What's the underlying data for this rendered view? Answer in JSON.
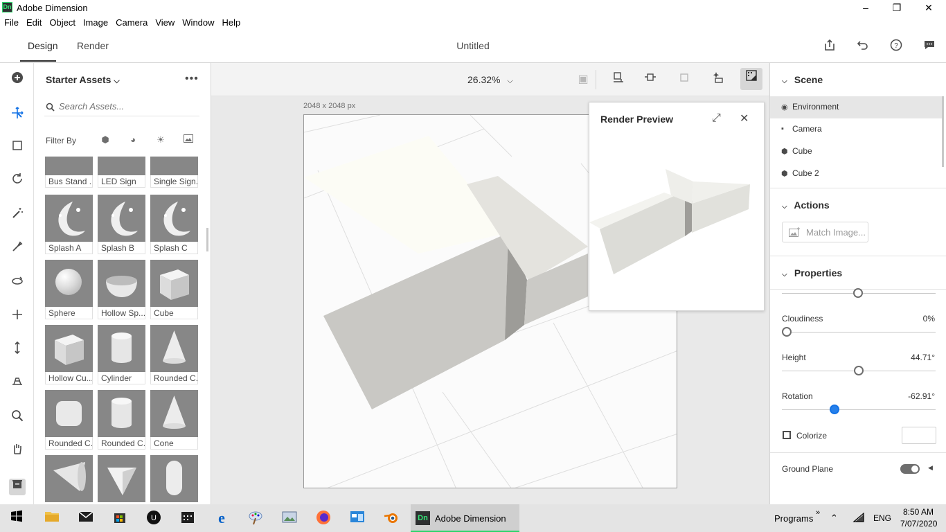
{
  "window": {
    "title": "Adobe Dimension",
    "logo_text": "Dn"
  },
  "menu": [
    "File",
    "Edit",
    "Object",
    "Image",
    "Camera",
    "View",
    "Window",
    "Help"
  ],
  "header": {
    "tabs": [
      {
        "label": "Design",
        "active": true
      },
      {
        "label": "Render",
        "active": false
      }
    ],
    "doc_title": "Untitled",
    "icons": [
      "share-icon",
      "undo-icon",
      "help-icon",
      "feedback-icon"
    ]
  },
  "tools": [
    "add-icon",
    "select-icon",
    "marquee-icon",
    "orbit-icon",
    "magic-wand-icon",
    "sampler-icon",
    "rotate-icon",
    "move-icon",
    "scale-icon",
    "camera-orbit-icon",
    "zoom-icon",
    "pan-icon",
    "library-icon"
  ],
  "assets": {
    "title": "Starter Assets",
    "search_placeholder": "Search Assets...",
    "filter_label": "Filter By",
    "items": [
      {
        "label": "Bus Stand ...",
        "kind": "dark"
      },
      {
        "label": "LED Sign",
        "kind": "dark"
      },
      {
        "label": "Single Sign...",
        "kind": "dark"
      },
      {
        "label": "Splash A",
        "kind": "splash"
      },
      {
        "label": "Splash B",
        "kind": "splash"
      },
      {
        "label": "Splash C",
        "kind": "splash"
      },
      {
        "label": "Sphere",
        "kind": "sphere"
      },
      {
        "label": "Hollow Sp...",
        "kind": "bowl"
      },
      {
        "label": "Cube",
        "kind": "cube"
      },
      {
        "label": "Hollow Cu...",
        "kind": "cube"
      },
      {
        "label": "Cylinder",
        "kind": "cylinder"
      },
      {
        "label": "Rounded C...",
        "kind": "cone"
      },
      {
        "label": "Rounded C...",
        "kind": "rcube"
      },
      {
        "label": "Rounded C...",
        "kind": "cylinder"
      },
      {
        "label": "Cone",
        "kind": "cone"
      },
      {
        "label": "",
        "kind": "cone2"
      },
      {
        "label": "",
        "kind": "prism"
      },
      {
        "label": "",
        "kind": "capsule"
      }
    ]
  },
  "canvas": {
    "zoom": "26.32%",
    "doc_size": "2048 x 2048 px"
  },
  "render_preview": {
    "title": "Render Preview"
  },
  "scene": {
    "title": "Scene",
    "items": [
      {
        "label": "Environment",
        "icon": "environment-icon",
        "selected": true
      },
      {
        "label": "Camera",
        "icon": "camera-icon",
        "selected": false
      },
      {
        "label": "Cube",
        "icon": "cube-icon",
        "selected": false
      },
      {
        "label": "Cube 2",
        "icon": "cube-icon",
        "selected": false
      }
    ]
  },
  "actions": {
    "title": "Actions",
    "match_image": "Match Image..."
  },
  "properties": {
    "title": "Properties",
    "cloudiness": {
      "label": "Cloudiness",
      "value": "0%",
      "fraction": 0
    },
    "height": {
      "label": "Height",
      "value": "44.71°",
      "fraction": 0.5
    },
    "rotation": {
      "label": "Rotation",
      "value": "-62.91°",
      "fraction": 0.33
    },
    "colorize": {
      "label": "Colorize",
      "checked": false,
      "color": "#ffffff"
    },
    "ground_plane": {
      "label": "Ground Plane",
      "on": true
    }
  },
  "taskbar": {
    "active_app": "Adobe Dimension",
    "programs": "Programs",
    "lang": "ENG",
    "time": "8:50 AM",
    "date": "7/07/2020"
  },
  "colors": {
    "accent": "#1473e6",
    "brand": "#35e476"
  }
}
